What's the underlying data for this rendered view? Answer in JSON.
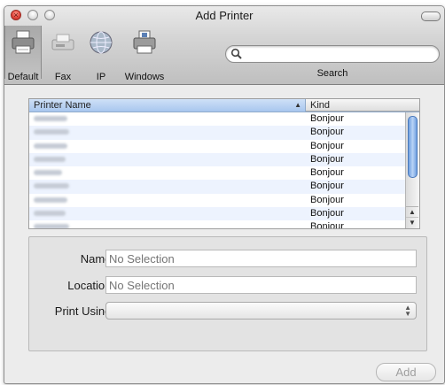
{
  "window": {
    "title": "Add Printer"
  },
  "toolbar": {
    "buttons": [
      {
        "label": "Default",
        "icon": "printer-icon"
      },
      {
        "label": "Fax",
        "icon": "fax-icon"
      },
      {
        "label": "IP",
        "icon": "globe-icon"
      },
      {
        "label": "Windows",
        "icon": "windows-printer-icon"
      }
    ],
    "search_label": "Search",
    "search_value": ""
  },
  "printer_table": {
    "columns": [
      "Printer Name",
      "Kind"
    ],
    "sort_indicator": "▲",
    "rows": [
      {
        "kind": "Bonjour"
      },
      {
        "kind": "Bonjour"
      },
      {
        "kind": "Bonjour"
      },
      {
        "kind": "Bonjour"
      },
      {
        "kind": "Bonjour"
      },
      {
        "kind": "Bonjour"
      },
      {
        "kind": "Bonjour"
      },
      {
        "kind": "Bonjour"
      },
      {
        "kind": "Bonjour"
      }
    ]
  },
  "form": {
    "name_label": "Name:",
    "name_placeholder": "No Selection",
    "location_label": "Location:",
    "location_placeholder": "No Selection",
    "print_using_label": "Print Using:",
    "print_using_value": ""
  },
  "actions": {
    "add_label": "Add"
  }
}
